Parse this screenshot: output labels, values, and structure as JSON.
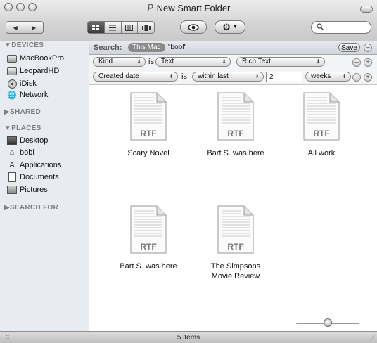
{
  "window": {
    "title": "New Smart Folder"
  },
  "toolbar": {
    "view_modes": [
      "icon",
      "list",
      "columns",
      "coverflow"
    ],
    "active_view": "icon"
  },
  "sidebar": {
    "devices_header": "▼DEVICES",
    "devices": [
      "MacBookPro",
      "LeopardHD",
      "iDisk",
      "Network"
    ],
    "shared_header": "▶SHARED",
    "places_header": "▼PLACES",
    "places": [
      "Desktop",
      "bobl",
      "Applications",
      "Documents",
      "Pictures"
    ],
    "search_header": "▶SEARCH FOR"
  },
  "search_bar": {
    "label": "Search:",
    "scope_active": "This Mac",
    "scope_other": "\"bobl\"",
    "save_label": "Save"
  },
  "criteria": [
    {
      "attribute": "Kind",
      "operator": "is",
      "value": "Text",
      "value2": "Rich Text"
    },
    {
      "attribute": "Created date",
      "operator": "is",
      "value": "within last",
      "amount": "2",
      "unit": "weeks"
    }
  ],
  "files": [
    {
      "type_label": "RTF",
      "name": "Scary Novel"
    },
    {
      "type_label": "RTF",
      "name": "Bart S. was here"
    },
    {
      "type_label": "RTF",
      "name": "All work"
    },
    {
      "type_label": "RTF",
      "name": "Bart S. was here"
    },
    {
      "type_label": "RTF",
      "name": "The Simpsons Movie Review"
    }
  ],
  "status": {
    "items_text": "5 items"
  }
}
